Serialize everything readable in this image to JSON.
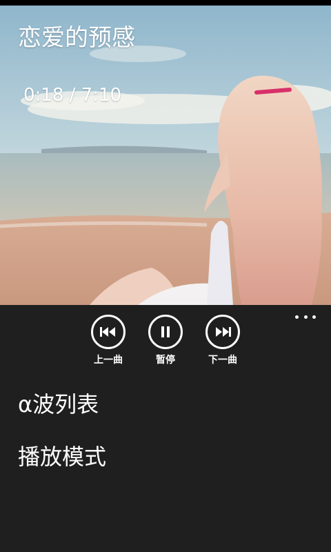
{
  "player": {
    "song_title": "恋爱的预感",
    "time_readout": "0:18 / 7:10"
  },
  "controls": {
    "previous_label": "上一曲",
    "pause_label": "暂停",
    "next_label": "下一曲"
  },
  "menu": {
    "items": [
      {
        "label": "α波列表"
      },
      {
        "label": "播放模式"
      }
    ]
  },
  "colors": {
    "panel_background": "#1f1f1f",
    "foreground": "#ffffff",
    "status_strip": "#000000"
  },
  "icons": {
    "previous": "skip-previous-icon",
    "pause": "pause-icon",
    "next": "skip-next-icon",
    "more": "ellipsis-icon"
  }
}
